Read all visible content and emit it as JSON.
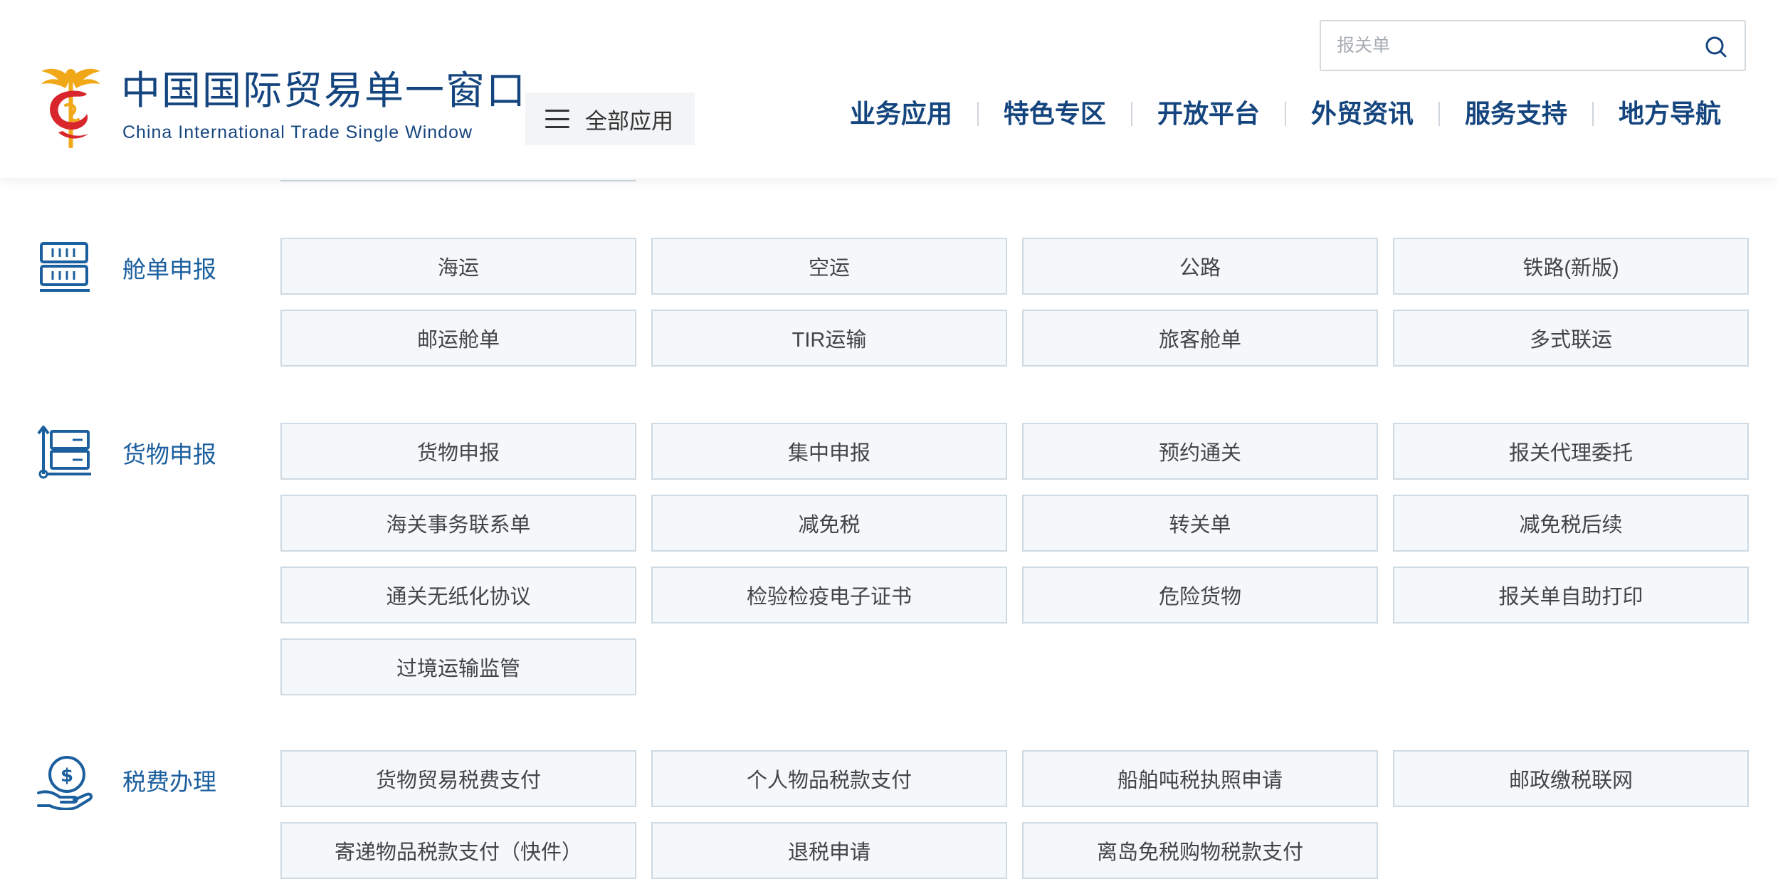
{
  "header": {
    "logo_title": "中国国际贸易单一窗口",
    "logo_subtitle": "China International Trade Single Window",
    "all_apps_label": "全部应用",
    "search_placeholder": "报关单",
    "nav": [
      "业务应用",
      "特色专区",
      "开放平台",
      "外贸资讯",
      "服务支持",
      "地方导航"
    ]
  },
  "sections": [
    {
      "icon": "manifest-icon",
      "label": "舱单申报",
      "items": [
        "海运",
        "空运",
        "公路",
        "铁路(新版)",
        "邮运舱单",
        "TIR运输",
        "旅客舱单",
        "多式联运"
      ]
    },
    {
      "icon": "cargo-icon",
      "label": "货物申报",
      "items": [
        "货物申报",
        "集中申报",
        "预约通关",
        "报关代理委托",
        "海关事务联系单",
        "减免税",
        "转关单",
        "减免税后续",
        "通关无纸化协议",
        "检验检疫电子证书",
        "危险货物",
        "报关单自助打印",
        "过境运输监管"
      ]
    },
    {
      "icon": "tax-payment-icon",
      "label": "税费办理",
      "items": [
        "货物贸易税费支付",
        "个人物品税款支付",
        "船舶吨税执照申请",
        "邮政缴税联网",
        "寄递物品税款支付（快件）",
        "退税申请",
        "离岛免税购物税款支付"
      ]
    }
  ],
  "colors": {
    "brand_blue": "#15457e",
    "section_label_blue": "#1b5f9e",
    "tile_bg": "#f4f8fb",
    "tile_border": "#cfdae2",
    "logo_red": "#d8262c",
    "logo_gold": "#f0a818"
  }
}
